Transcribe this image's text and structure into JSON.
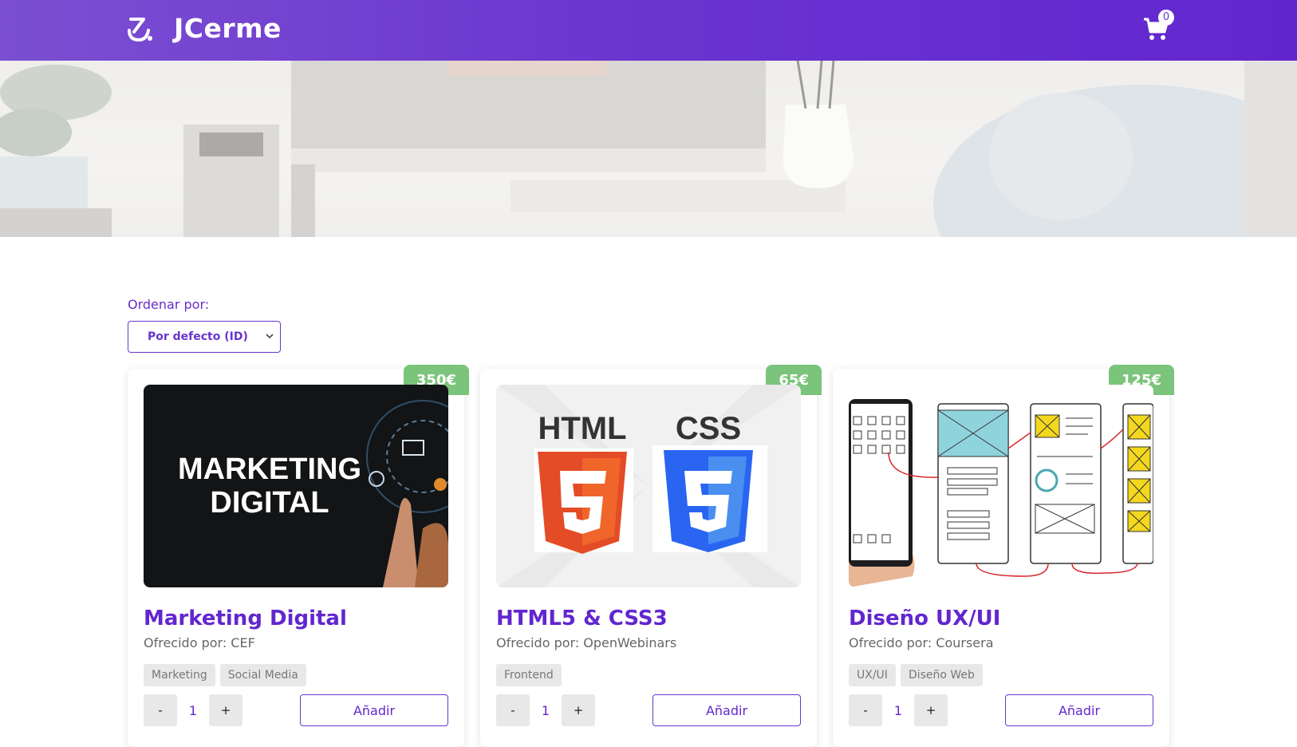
{
  "header": {
    "brand": "JCerme",
    "cart_count": "0"
  },
  "sort": {
    "label": "Ordenar por:",
    "selected": "Por defecto (ID)"
  },
  "courses": [
    {
      "price": "350€",
      "title": "Marketing Digital",
      "provider": "Ofrecido por: CEF",
      "tags": [
        "Marketing",
        "Social Media"
      ],
      "qty": "1",
      "minus": "-",
      "plus": "+",
      "add_label": "Añadir",
      "image_text": [
        "MARKETING",
        "DIGITAL"
      ]
    },
    {
      "price": "65€",
      "title": "HTML5 & CSS3",
      "provider": "Ofrecido por: OpenWebinars",
      "tags": [
        "Frontend"
      ],
      "qty": "1",
      "minus": "-",
      "plus": "+",
      "add_label": "Añadir",
      "image_text": [
        "HTML",
        "CSS"
      ]
    },
    {
      "price": "125€",
      "title": "Diseño UX/UI",
      "provider": "Ofrecido por: Coursera",
      "tags": [
        "UX/UI",
        "Diseño Web"
      ],
      "qty": "1",
      "minus": "-",
      "plus": "+",
      "add_label": "Añadir"
    }
  ],
  "colors": {
    "accent": "#6a34d0",
    "price_badge": "#7bc47b"
  }
}
